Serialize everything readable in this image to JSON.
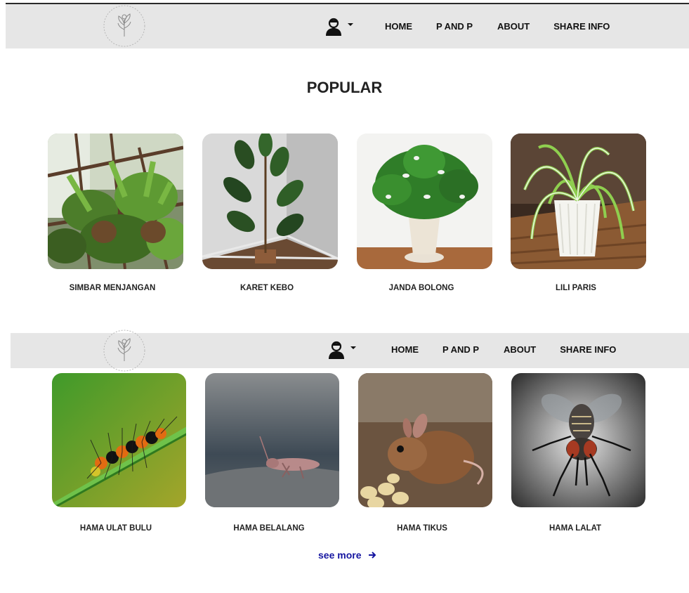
{
  "nav": {
    "links": [
      "HOME",
      "P AND P",
      "ABOUT",
      "SHARE INFO"
    ]
  },
  "popular": {
    "title": "POPULAR",
    "plants": [
      {
        "name": "SIMBAR MENJANGAN"
      },
      {
        "name": "KARET KEBO"
      },
      {
        "name": "JANDA BOLONG"
      },
      {
        "name": "LILI PARIS"
      }
    ]
  },
  "pests": {
    "items": [
      {
        "name": "HAMA ULAT BULU"
      },
      {
        "name": "HAMA BELALANG"
      },
      {
        "name": "HAMA TIKUS"
      },
      {
        "name": "HAMA LALAT"
      }
    ],
    "see_more": "see more"
  },
  "colors": {
    "navbar_bg": "#e6e6e6",
    "link_accent": "#1515a0"
  }
}
